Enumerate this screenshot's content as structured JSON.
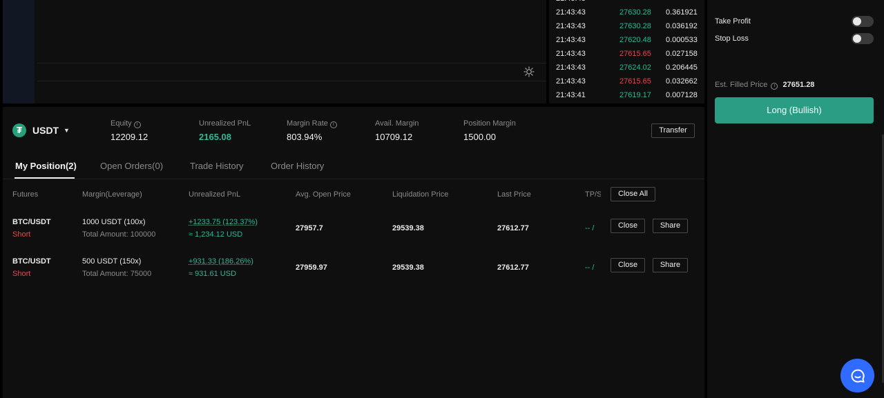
{
  "trades": [
    {
      "time": "21:43:43",
      "price": "27630.28",
      "amount": "0.361921",
      "dir": "up"
    },
    {
      "time": "21:43:43",
      "price": "27630.28",
      "amount": "0.036192",
      "dir": "up"
    },
    {
      "time": "21:43:43",
      "price": "27620.48",
      "amount": "0.000533",
      "dir": "up"
    },
    {
      "time": "21:43:43",
      "price": "27615.65",
      "amount": "0.027158",
      "dir": "down"
    },
    {
      "time": "21:43:43",
      "price": "27624.02",
      "amount": "0.206445",
      "dir": "up"
    },
    {
      "time": "21:43:43",
      "price": "27615.65",
      "amount": "0.032662",
      "dir": "down"
    },
    {
      "time": "21:43:41",
      "price": "27619.17",
      "amount": "0.007128",
      "dir": "up"
    }
  ],
  "order_form": {
    "take_profit_label": "Take Profit",
    "stop_loss_label": "Stop Loss",
    "est_filled_label": "Est. Filled Price",
    "est_filled_value": "27651.28",
    "long_button": "Long (Bullish)"
  },
  "account": {
    "currency": "USDT",
    "equity_label": "Equity",
    "equity": "12209.12",
    "unrealized_label": "Unrealized PnL",
    "unrealized": "2165.08",
    "margin_rate_label": "Margin Rate",
    "margin_rate": "803.94%",
    "avail_margin_label": "Avail. Margin",
    "avail_margin": "10709.12",
    "position_margin_label": "Position Margin",
    "position_margin": "1500.00",
    "transfer_button": "Transfer"
  },
  "tabs": [
    "My Position(2)",
    "Open Orders(0)",
    "Trade History",
    "Order History"
  ],
  "columns": {
    "futures": "Futures",
    "margin": "Margin(Leverage)",
    "pnl": "Unrealized PnL",
    "avg_open": "Avg. Open Price",
    "liquidation": "Liquidation Price",
    "last": "Last Price",
    "tpsl": "TP/S",
    "close_all": "Close All"
  },
  "positions": [
    {
      "symbol": "BTC/USDT",
      "side": "Short",
      "margin": "1000 USDT (100x)",
      "total_amount": "Total Amount: 100000",
      "pnl": "+1233.75 (123.37%)",
      "pnl_usd": "≈ 1,234.12 USD",
      "avg_open": "27957.7",
      "liquidation": "29539.38",
      "last": "27612.77",
      "tpsl": "-- /",
      "close_label": "Close",
      "share_label": "Share"
    },
    {
      "symbol": "BTC/USDT",
      "side": "Short",
      "margin": "500 USDT (150x)",
      "total_amount": "Total Amount: 75000",
      "pnl": "+931.33 (186.26%)",
      "pnl_usd": "≈ 931.61 USD",
      "avg_open": "27959.97",
      "liquidation": "29539.38",
      "last": "27612.77",
      "tpsl": "-- /",
      "close_label": "Close",
      "share_label": "Share"
    }
  ],
  "colors": {
    "up": "#2fb996",
    "down": "#e5484d",
    "accent": "#2a9d84",
    "chat": "#2f6bff"
  },
  "icons": {
    "chart_settings": "gear-icon",
    "chat": "chat-bubble-icon",
    "info": "info-icon",
    "currency": "tether-icon"
  }
}
